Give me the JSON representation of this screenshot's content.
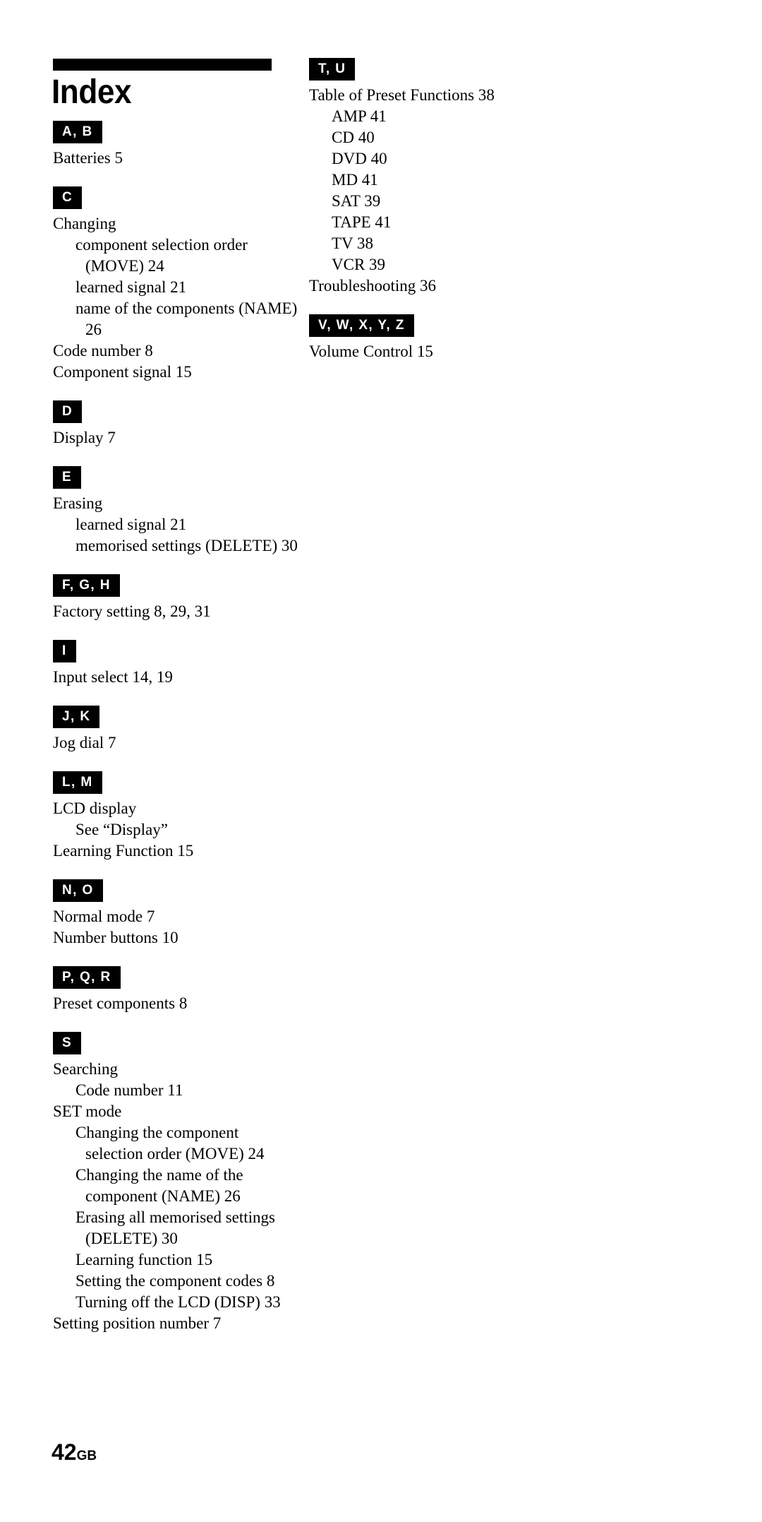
{
  "page": {
    "title": "Index",
    "footer_page_number": "42",
    "footer_region_code": "GB"
  },
  "columns": {
    "left": [
      {
        "heading": "A, B",
        "entries": [
          {
            "text": "Batteries  5",
            "level": 0
          }
        ]
      },
      {
        "heading": "C",
        "entries": [
          {
            "text": "Changing",
            "level": 0
          },
          {
            "text": "component selection order",
            "level": 1
          },
          {
            "text": "(MOVE) 24",
            "level": 2
          },
          {
            "text": "learned signal  21",
            "level": 1
          },
          {
            "text": "name of the components (NAME)",
            "level": 1
          },
          {
            "text": "26",
            "level": 2
          },
          {
            "text": "Code number 8",
            "level": 0
          },
          {
            "text": "Component signal  15",
            "level": 0
          }
        ]
      },
      {
        "heading": "D",
        "entries": [
          {
            "text": "Display 7",
            "level": 0
          }
        ]
      },
      {
        "heading": "E",
        "entries": [
          {
            "text": "Erasing",
            "level": 0
          },
          {
            "text": "learned signal  21",
            "level": 1
          },
          {
            "text": "memorised settings (DELETE) 30",
            "level": 1
          }
        ]
      },
      {
        "heading": "F, G, H",
        "entries": [
          {
            "text": "Factory setting  8, 29, 31",
            "level": 0
          }
        ]
      },
      {
        "heading": "I",
        "entries": [
          {
            "text": "Input select  14, 19",
            "level": 0
          }
        ]
      },
      {
        "heading": "J, K",
        "entries": [
          {
            "text": "Jog dial 7",
            "level": 0
          }
        ]
      },
      {
        "heading": "L, M",
        "entries": [
          {
            "text": "LCD display",
            "level": 0
          },
          {
            "text": "See “Display”",
            "level": 1
          },
          {
            "text": "Learning Function  15",
            "level": 0
          }
        ]
      },
      {
        "heading": "N, O",
        "entries": [
          {
            "text": "Normal mode 7",
            "level": 0
          },
          {
            "text": "Number buttons  10",
            "level": 0
          }
        ]
      },
      {
        "heading": "P, Q, R",
        "entries": [
          {
            "text": "Preset components  8",
            "level": 0
          }
        ]
      },
      {
        "heading": "S",
        "entries": [
          {
            "text": "Searching",
            "level": 0
          },
          {
            "text": "Code number 11",
            "level": 1
          },
          {
            "text": "SET mode",
            "level": 0
          },
          {
            "text": "Changing the component",
            "level": 1
          },
          {
            "text": "selection order (MOVE) 24",
            "level": 2
          },
          {
            "text": "Changing the name of the",
            "level": 1
          },
          {
            "text": "component (NAME) 26",
            "level": 2
          },
          {
            "text": "Erasing all memorised settings",
            "level": 1
          },
          {
            "text": "(DELETE) 30",
            "level": 2
          },
          {
            "text": "Learning function 15",
            "level": 1
          },
          {
            "text": "Setting the component codes 8",
            "level": 1
          },
          {
            "text": "Turning off the LCD (DISP) 33",
            "level": 1
          },
          {
            "text": "Setting position number 7",
            "level": 0
          }
        ]
      }
    ],
    "right": [
      {
        "heading": "T, U",
        "entries": [
          {
            "text": "Table of Preset Functions 38",
            "level": 0
          },
          {
            "text": "AMP 41",
            "level": 1
          },
          {
            "text": "CD 40",
            "level": 1
          },
          {
            "text": "DVD 40",
            "level": 1
          },
          {
            "text": "MD 41",
            "level": 1
          },
          {
            "text": "SAT 39",
            "level": 1
          },
          {
            "text": "TAPE 41",
            "level": 1
          },
          {
            "text": "TV 38",
            "level": 1
          },
          {
            "text": "VCR 39",
            "level": 1
          },
          {
            "text": "Troubleshooting  36",
            "level": 0
          }
        ]
      },
      {
        "heading": "V, W, X, Y, Z",
        "entries": [
          {
            "text": "Volume Control  15",
            "level": 0
          }
        ]
      }
    ]
  }
}
